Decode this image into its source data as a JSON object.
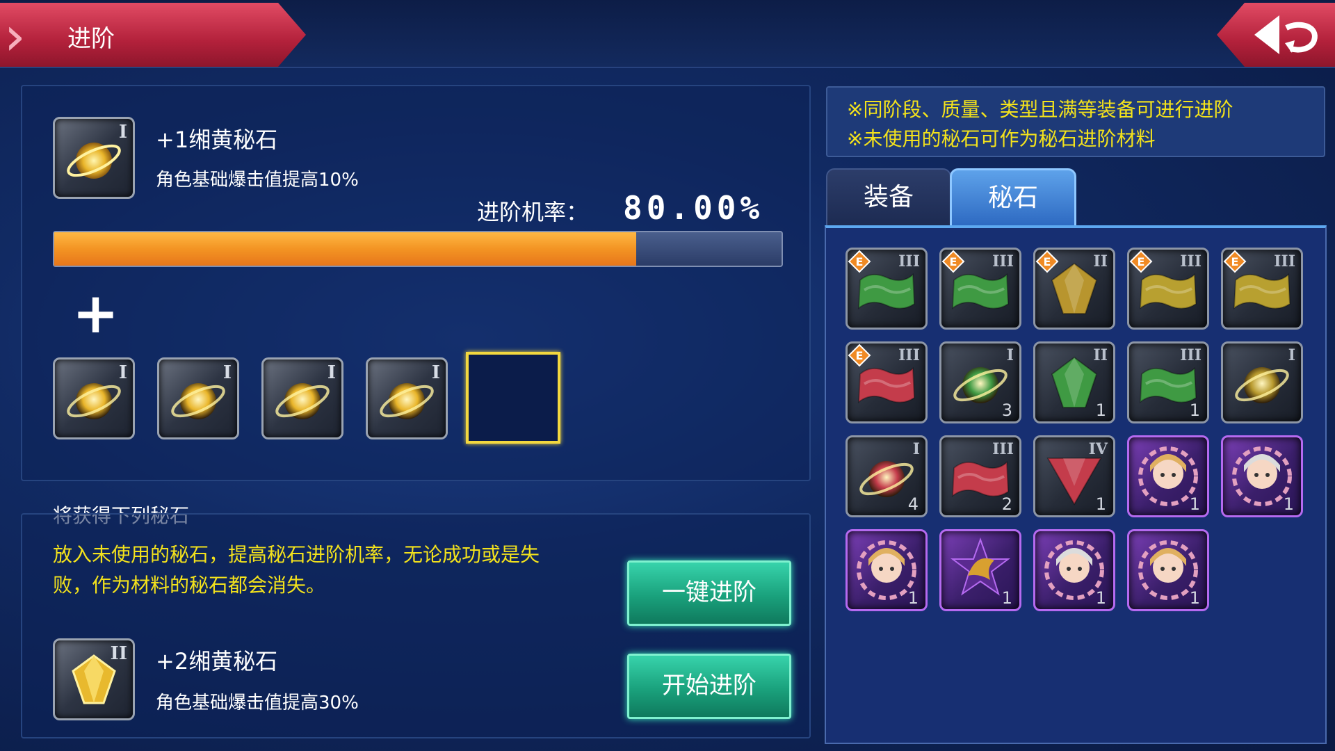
{
  "header": {
    "title": "进阶"
  },
  "colors": {
    "accent": "#c4283f",
    "progress": "#f39423",
    "tip_text": "#f3e21c",
    "button": "#1aa17c"
  },
  "upgrade": {
    "current": {
      "name": "+1缃黄秘石",
      "desc": "角色基础爆击值提高10%",
      "tier": "I",
      "icon": "yellow-orb-icon"
    },
    "rate_label": "进阶机率：",
    "rate_value": "80.00%",
    "rate_fraction": 0.8,
    "materials": [
      {
        "tier": "I",
        "icon": "yellow-orb-icon"
      },
      {
        "tier": "I",
        "icon": "yellow-orb-icon"
      },
      {
        "tier": "I",
        "icon": "yellow-orb-icon"
      },
      {
        "tier": "I",
        "icon": "yellow-orb-icon"
      }
    ]
  },
  "result": {
    "section_label": "将获得下列秘石",
    "note": "放入未使用的秘石，提高秘石进阶机率，无论成功或是失败，作为材料的秘石都会消失。",
    "item": {
      "name": "+2缃黄秘石",
      "desc": "角色基础爆击值提高30%",
      "tier": "II",
      "icon": "yellow-gem-icon"
    },
    "one_click_label": "一键进阶",
    "start_label": "开始进阶"
  },
  "tips": [
    "※同阶段、质量、类型且满等装备可进行进阶",
    "※未使用的秘石可作为秘石进阶材料"
  ],
  "tabs": [
    {
      "label": "装备",
      "active": false
    },
    {
      "label": "秘石",
      "active": true
    }
  ],
  "inventory": [
    {
      "tier": "III",
      "color": "#3f9a43",
      "shape": "wave",
      "grade": "E",
      "qty": ""
    },
    {
      "tier": "III",
      "color": "#3f9a43",
      "shape": "wave",
      "grade": "E",
      "qty": ""
    },
    {
      "tier": "II",
      "color": "#b8952e",
      "shape": "gem",
      "grade": "E",
      "qty": ""
    },
    {
      "tier": "III",
      "color": "#b8a030",
      "shape": "wave",
      "grade": "E",
      "qty": ""
    },
    {
      "tier": "III",
      "color": "#b8a030",
      "shape": "wave",
      "grade": "E",
      "qty": ""
    },
    {
      "tier": "III",
      "color": "#c43c4b",
      "shape": "wave",
      "grade": "E",
      "qty": ""
    },
    {
      "tier": "I",
      "color": "#3f9a43",
      "shape": "orb",
      "grade": "",
      "qty": "3"
    },
    {
      "tier": "II",
      "color": "#3f9a43",
      "shape": "gem",
      "grade": "",
      "qty": "1"
    },
    {
      "tier": "III",
      "color": "#3f9a43",
      "shape": "wave",
      "grade": "",
      "qty": "1"
    },
    {
      "tier": "I",
      "color": "#b89a2e",
      "shape": "orb",
      "grade": "",
      "qty": ""
    },
    {
      "tier": "I",
      "color": "#c43c4b",
      "shape": "orb",
      "grade": "",
      "qty": "4"
    },
    {
      "tier": "III",
      "color": "#c43c4b",
      "shape": "wave",
      "grade": "",
      "qty": "2"
    },
    {
      "tier": "IV",
      "color": "#c43c4b",
      "shape": "triangle",
      "grade": "",
      "qty": "1"
    },
    {
      "tier": "",
      "color": "#e0b060",
      "shape": "character",
      "grade": "",
      "qty": "1",
      "purple": true
    },
    {
      "tier": "",
      "color": "#dcdcdc",
      "shape": "character",
      "grade": "",
      "qty": "1",
      "purple": true
    },
    {
      "tier": "",
      "color": "#e0b060",
      "shape": "character",
      "grade": "",
      "qty": "1",
      "purple": true
    },
    {
      "tier": "",
      "color": "#d8a030",
      "shape": "emblem",
      "grade": "",
      "qty": "1",
      "purple": true
    },
    {
      "tier": "",
      "color": "#dcdcdc",
      "shape": "character",
      "grade": "",
      "qty": "1",
      "purple": true
    },
    {
      "tier": "",
      "color": "#e0b060",
      "shape": "character",
      "grade": "",
      "qty": "1",
      "purple": true
    }
  ]
}
